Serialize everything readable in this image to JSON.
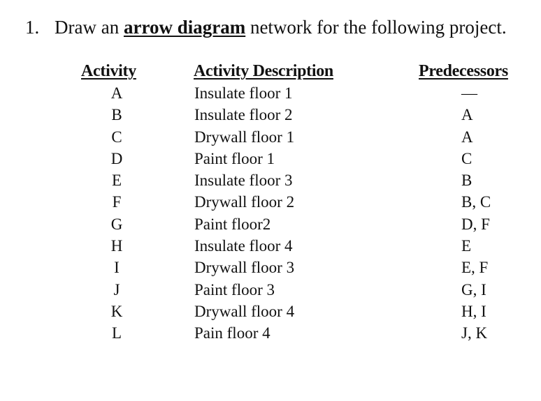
{
  "question": {
    "number": "1.",
    "text_before": "Draw an ",
    "emphasis": "arrow diagram",
    "text_after": " network for the following project."
  },
  "table": {
    "headers": {
      "activity": "Activity",
      "description": "Activity Description",
      "predecessors": "Predecessors"
    },
    "rows": [
      {
        "activity": "A",
        "description": "Insulate floor 1",
        "predecessors": "—"
      },
      {
        "activity": "B",
        "description": "Insulate floor 2",
        "predecessors": "A"
      },
      {
        "activity": "C",
        "description": "Drywall floor 1",
        "predecessors": "A"
      },
      {
        "activity": "D",
        "description": "Paint floor 1",
        "predecessors": "C"
      },
      {
        "activity": "E",
        "description": "Insulate floor 3",
        "predecessors": "B"
      },
      {
        "activity": "F",
        "description": "Drywall floor 2",
        "predecessors": "B, C"
      },
      {
        "activity": "G",
        "description": "Paint floor2",
        "predecessors": "D, F"
      },
      {
        "activity": "H",
        "description": "Insulate floor 4",
        "predecessors": "E"
      },
      {
        "activity": "I",
        "description": "Drywall floor 3",
        "predecessors": "E, F"
      },
      {
        "activity": "J",
        "description": "Paint floor 3",
        "predecessors": "G, I"
      },
      {
        "activity": "K",
        "description": "Drywall floor 4",
        "predecessors": "H, I"
      },
      {
        "activity": "L",
        "description": "Pain floor 4",
        "predecessors": "J, K"
      }
    ]
  }
}
